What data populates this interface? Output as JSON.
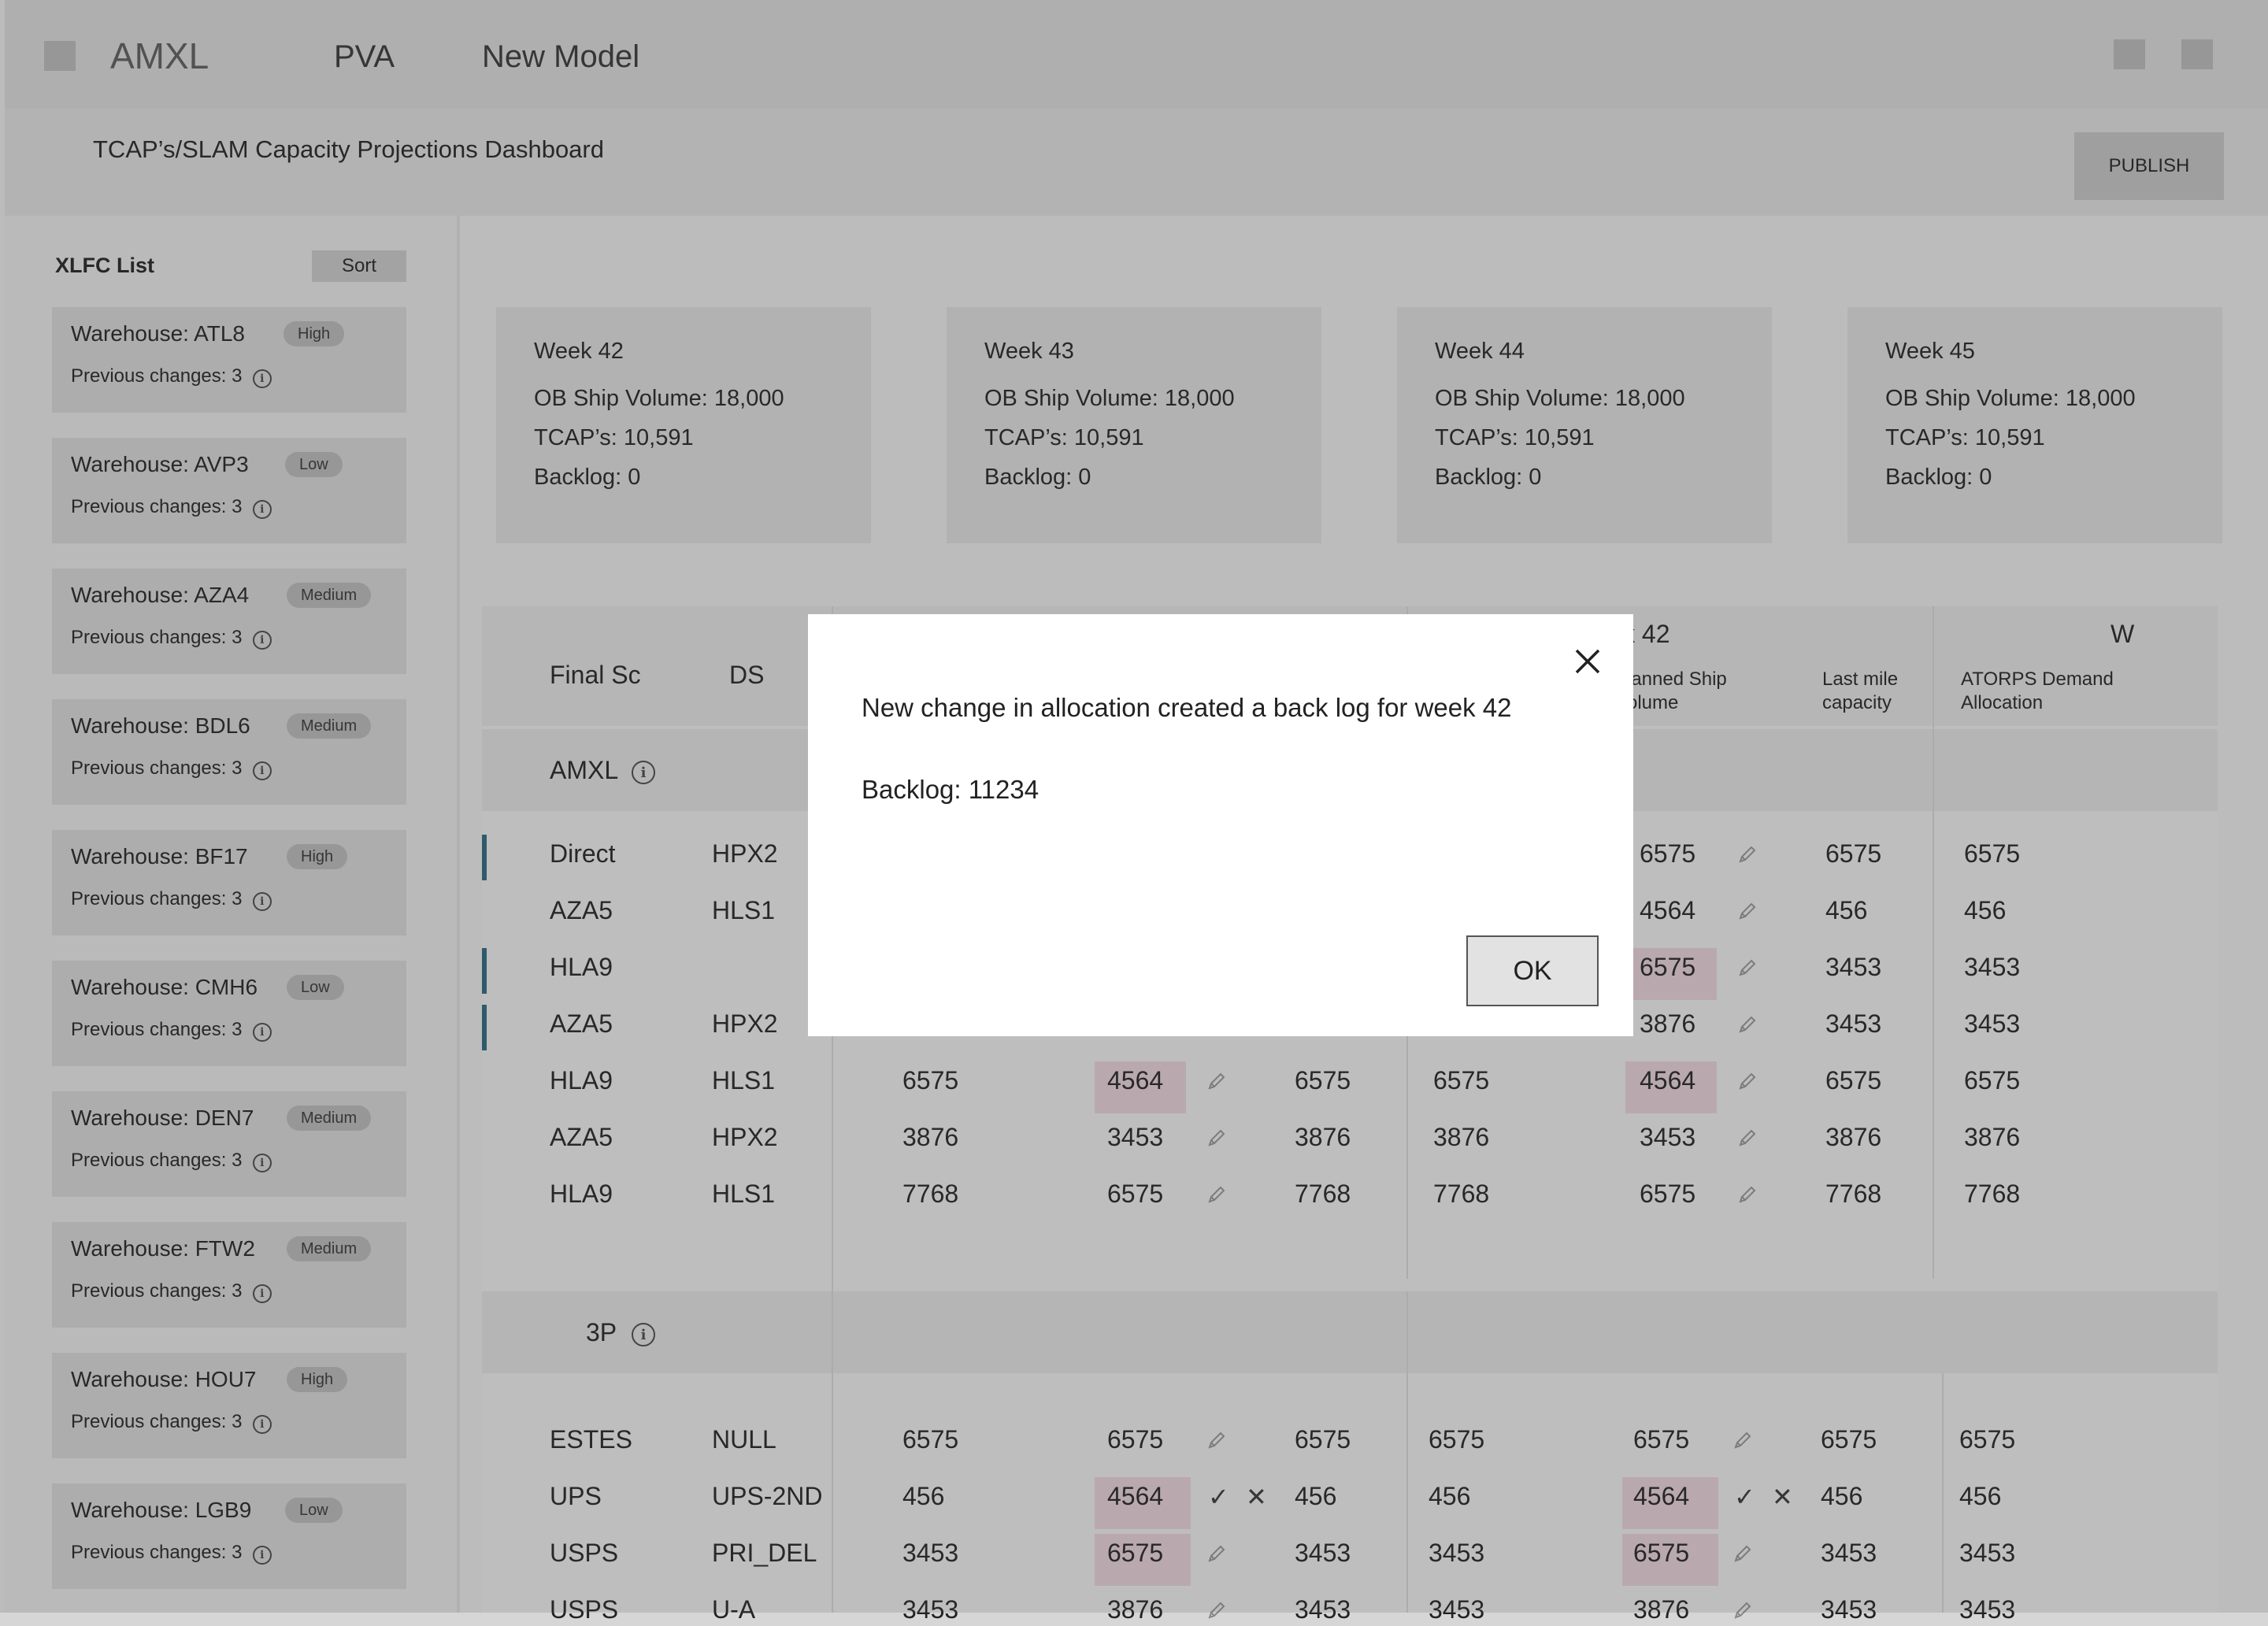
{
  "topbar": {
    "brand": "AMXL",
    "nav": [
      "PVA",
      "New Model"
    ]
  },
  "header": {
    "title": "TCAP’s/SLAM Capacity Projections Dashboard",
    "publish_label": "PUBLISH"
  },
  "sidebar": {
    "title": "XLFC List",
    "sort_label": "Sort",
    "items": [
      {
        "name": "Warehouse: ATL8",
        "priority": "High",
        "changes": "Previous changes: 3"
      },
      {
        "name": "Warehouse: AVP3",
        "priority": "Low",
        "changes": "Previous changes: 3"
      },
      {
        "name": "Warehouse: AZA4",
        "priority": "Medium",
        "changes": "Previous changes: 3"
      },
      {
        "name": "Warehouse: BDL6",
        "priority": "Medium",
        "changes": "Previous changes: 3"
      },
      {
        "name": "Warehouse: BF17",
        "priority": "High",
        "changes": "Previous changes: 3"
      },
      {
        "name": "Warehouse: CMH6",
        "priority": "Low",
        "changes": "Previous changes: 3"
      },
      {
        "name": "Warehouse: DEN7",
        "priority": "Medium",
        "changes": "Previous changes: 3"
      },
      {
        "name": "Warehouse: FTW2",
        "priority": "Medium",
        "changes": "Previous changes: 3"
      },
      {
        "name": "Warehouse: HOU7",
        "priority": "High",
        "changes": "Previous changes: 3"
      },
      {
        "name": "Warehouse: LGB9",
        "priority": "Low",
        "changes": "Previous changes: 3"
      }
    ]
  },
  "weeks": [
    {
      "title": "Week 42",
      "ob": "OB Ship Volume: 18,000",
      "tcaps": "TCAP’s: 10,591",
      "backlog": "Backlog: 0"
    },
    {
      "title": "Week 43",
      "ob": "OB Ship Volume: 18,000",
      "tcaps": "TCAP’s: 10,591",
      "backlog": "Backlog: 0"
    },
    {
      "title": "Week 44",
      "ob": "OB Ship Volume: 18,000",
      "tcaps": "TCAP’s: 10,591",
      "backlog": "Backlog: 0"
    },
    {
      "title": "Week 45",
      "ob": "OB Ship Volume: 18,000",
      "tcaps": "TCAP’s: 10,591",
      "backlog": "Backlog: 0"
    }
  ],
  "table": {
    "col_final_sc": "Final Sc",
    "col_ds": "DS",
    "week_header": "k 42",
    "week_header_next": "W",
    "col_planned": "lanned Ship\nolume",
    "col_lastmile": "Last mile\ncapacity",
    "col_atorps": "ATORPS Demand\nAllocation",
    "group_amxl": "AMXL",
    "group_3p": "3P",
    "amxl_rows": [
      {
        "sc": "Direct",
        "ds": "HPX2",
        "w43a": "",
        "w43b": "",
        "w43c": "",
        "w42a": "",
        "w42b": "6575",
        "w42c": "6575",
        "w42d": "6575"
      },
      {
        "sc": "AZA5",
        "ds": "HLS1",
        "w43a": "",
        "w43b": "",
        "w43c": "",
        "w42a": "",
        "w42b": "4564",
        "w42c": "456",
        "w42d": "456"
      },
      {
        "sc": "HLA9",
        "ds": "",
        "w43a": "",
        "w43b": "",
        "w43c": "",
        "w42a": "",
        "w42b": "6575",
        "w42c": "3453",
        "w42d": "3453"
      },
      {
        "sc": "AZA5",
        "ds": "HPX2",
        "w43a": "",
        "w43b": "",
        "w43c": "",
        "w42a": "",
        "w42b": "3876",
        "w42c": "3453",
        "w42d": "3453"
      },
      {
        "sc": "HLA9",
        "ds": "HLS1",
        "w43a": "6575",
        "w43b": "4564",
        "w43c": "6575",
        "w42a": "6575",
        "w42b": "4564",
        "w42c": "6575",
        "w42d": "6575"
      },
      {
        "sc": "AZA5",
        "ds": "HPX2",
        "w43a": "3876",
        "w43b": "3453",
        "w43c": "3876",
        "w42a": "3876",
        "w42b": "3453",
        "w42c": "3876",
        "w42d": "3876"
      },
      {
        "sc": "HLA9",
        "ds": "HLS1",
        "w43a": "7768",
        "w43b": "6575",
        "w43c": "7768",
        "w42a": "7768",
        "w42b": "6575",
        "w42c": "7768",
        "w42d": "7768"
      }
    ],
    "p3_rows": [
      {
        "sc": "ESTES",
        "ds": "NULL",
        "w43a": "6575",
        "w43b": "6575",
        "w43c": "6575",
        "w42a": "6575",
        "w42b": "6575",
        "w42c": "6575",
        "w42d": "6575"
      },
      {
        "sc": "UPS",
        "ds": "UPS-2ND",
        "w43a": "456",
        "w43b": "4564",
        "w43c": "456",
        "w42a": "456",
        "w42b": "4564",
        "w42c": "456",
        "w42d": "456"
      },
      {
        "sc": "USPS",
        "ds": "PRI_DEL",
        "w43a": "3453",
        "w43b": "6575",
        "w43c": "3453",
        "w42a": "3453",
        "w42b": "6575",
        "w42c": "3453",
        "w42d": "3453"
      },
      {
        "sc": "USPS",
        "ds": "U-A",
        "w43a": "3453",
        "w43b": "3876",
        "w43c": "3453",
        "w42a": "3453",
        "w42b": "3876",
        "w42c": "3453",
        "w42d": "3453"
      }
    ]
  },
  "dialog": {
    "message": "New change in allocation created a back log for week 42",
    "backlog": "Backlog: 11234",
    "ok_label": "OK"
  },
  "colors": {
    "highlight": "#d2bfc5",
    "row_marker": "#2a5f73"
  }
}
